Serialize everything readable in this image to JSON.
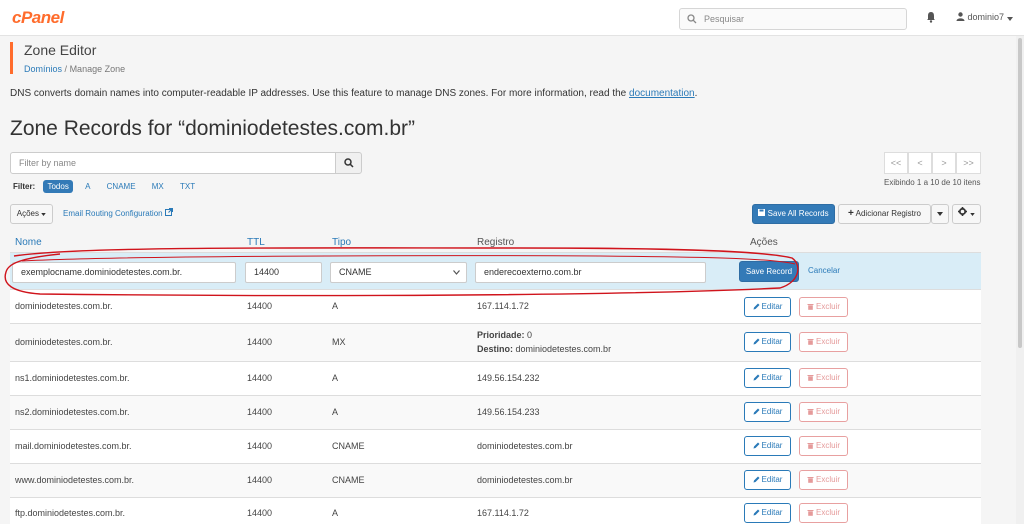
{
  "topbar": {
    "logo": "cPanel",
    "search_placeholder": "Pesquisar",
    "username": "dominio7"
  },
  "header": {
    "title": "Zone Editor",
    "breadcrumb": [
      "Domínios",
      "/",
      "Manage Zone"
    ]
  },
  "description": {
    "text": "DNS converts domain names into computer-readable IP addresses. Use this feature to manage DNS zones. For more information, read the ",
    "link": "documentation",
    "suffix": "."
  },
  "zone_title": "Zone Records for “dominiodetestes.com.br”",
  "filter": {
    "placeholder": "Filter by name",
    "label": "Filter:",
    "options": [
      {
        "label": "Todos",
        "active": true
      },
      {
        "label": "A"
      },
      {
        "label": "CNAME"
      },
      {
        "label": "MX"
      },
      {
        "label": "TXT"
      }
    ]
  },
  "pagination": {
    "first": "<<",
    "prev": "<",
    "next": ">",
    "last": ">>",
    "info": "Exibindo 1 a 10 de 10 itens"
  },
  "toolbar": {
    "actions": "Ações",
    "email_routing": "Email Routing Configuration",
    "save_all": "Save All Records",
    "add_record": "Adicionar Registro"
  },
  "table": {
    "headers": {
      "name": "Nome",
      "ttl": "TTL",
      "type": "Tipo",
      "record": "Registro",
      "actions": "Ações"
    },
    "editing": {
      "name": "exemplocname.dominiodetestes.com.br.",
      "ttl": "14400",
      "type": "CNAME",
      "record": "enderecoexterno.com.br",
      "save": "Save Record",
      "cancel": "Cancelar"
    },
    "edit_label": "Editar",
    "delete_label": "Excluir",
    "rows": [
      {
        "name": "dominiodetestes.com.br.",
        "ttl": "14400",
        "type": "A",
        "record": "167.114.1.72"
      },
      {
        "name": "dominiodetestes.com.br.",
        "ttl": "14400",
        "type": "MX",
        "priority_label": "Prioridade:",
        "priority": "0",
        "dest_label": "Destino:",
        "dest": "dominiodetestes.com.br"
      },
      {
        "name": "ns1.dominiodetestes.com.br.",
        "ttl": "14400",
        "type": "A",
        "record": "149.56.154.232"
      },
      {
        "name": "ns2.dominiodetestes.com.br.",
        "ttl": "14400",
        "type": "A",
        "record": "149.56.154.233"
      },
      {
        "name": "mail.dominiodetestes.com.br.",
        "ttl": "14400",
        "type": "CNAME",
        "record": "dominiodetestes.com.br"
      },
      {
        "name": "www.dominiodetestes.com.br.",
        "ttl": "14400",
        "type": "CNAME",
        "record": "dominiodetestes.com.br"
      },
      {
        "name": "ftp.dominiodetestes.com.br.",
        "ttl": "14400",
        "type": "A",
        "record": "167.114.1.72"
      }
    ]
  },
  "colors": {
    "brand": "#ff6c2c",
    "primary": "#337ab7",
    "link": "#2a7ab8",
    "edit_row": "#d9edf7",
    "annotation": "#d0141c"
  }
}
